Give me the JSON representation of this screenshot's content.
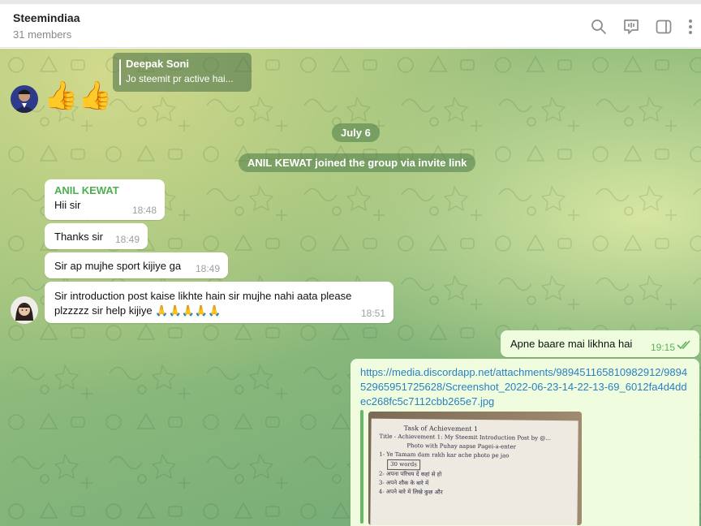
{
  "header": {
    "title": "Steemindiaa",
    "subtitle": "31 members",
    "icons": [
      "search-icon",
      "video-chat-icon",
      "sidebar-toggle-icon",
      "more-vertical-icon"
    ]
  },
  "reply": {
    "name": "Deepak Soni",
    "text": "Jo steemit pr active hai..."
  },
  "emoji_message": {
    "text": "👍👍"
  },
  "date_pill": "July 6",
  "service_message": "ANIL KEWAT joined the group via invite link",
  "messages": [
    {
      "sender": "ANIL KEWAT",
      "text": "Hii sir",
      "time": "18:48"
    },
    {
      "text": "Thanks sir",
      "time": "18:49"
    },
    {
      "text": "Sir ap mujhe sport kijiye ga",
      "time": "18:49"
    },
    {
      "line1": "Sir introduction post kaise likhte hain sir mujhe nahi aata please",
      "line2": "plzzzzz sir help kijiye 🙏🙏🙏🙏🙏",
      "time": "18:51"
    }
  ],
  "outgoing": {
    "text": "Apne baare mai likhna hai",
    "time": "19:15",
    "status": "double-check-icon"
  },
  "link_message": {
    "url": "https://media.discordapp.net/attachments/989451165810982912/989452965951725628/Screenshot_2022-06-23-14-22-13-69_6012fa4d4ddec268fc5c7112cbb265e7.jpg",
    "photo": {
      "title": "Task of Achievement 1",
      "subtitle": "Title - Achievement 1: My Steemit Introduction Post by @...",
      "lines": [
        "Photo with Puhay  aapse  Pagei-a-enter",
        "1- Ye Tamam dam rakh kar ache photo pe jao",
        "30 words",
        "2- अपना  परिचय  दें  कहां  से  हो",
        "3- अपने  शौक  के  बारे  में",
        "4- अपने  बारे  में  लिखे  कुछ  और"
      ]
    }
  },
  "colors": {
    "link": "#2b7fc2",
    "sender": "#4fae4e",
    "outgoing_bg": "#effdde",
    "pill_bg": "#5a8a52"
  }
}
